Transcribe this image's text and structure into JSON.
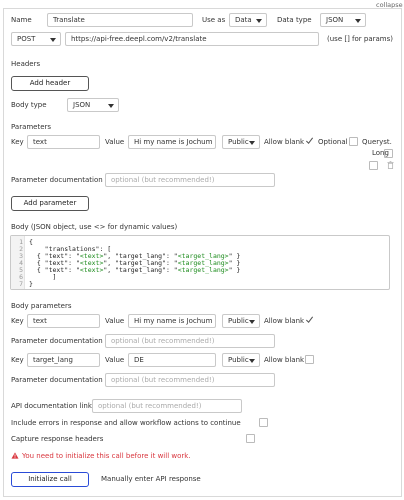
{
  "collapse_label": "collapse",
  "top": {
    "name_label": "Name",
    "name_value": "Translate",
    "use_as_label": "Use as",
    "use_as_value": "Data",
    "data_type_label": "Data type",
    "data_type_value": "JSON",
    "method": "POST",
    "url": "https://api-free.deepl.com/v2/translate",
    "params_hint": "(use [] for params)"
  },
  "headers": {
    "title": "Headers",
    "add_button": "Add header"
  },
  "body_type": {
    "label": "Body type",
    "value": "JSON"
  },
  "parameters": {
    "title": "Parameters",
    "key_label": "Key",
    "key_value": "text",
    "value_label": "Value",
    "value_value": "Hi my name is Jochum",
    "visibility": "Public",
    "allow_blank": "Allow blank",
    "optional": "Optional",
    "querystring": "Queryst.",
    "long": "Long",
    "doc_label": "Parameter documentation",
    "doc_placeholder": "optional (but recommended!)",
    "add_button": "Add parameter"
  },
  "body": {
    "label": "Body (JSON object, use <> for dynamic values)",
    "lines": [
      {
        "n": "1",
        "parts": [
          {
            "t": "{",
            "c": ""
          }
        ]
      },
      {
        "n": "2",
        "parts": [
          {
            "t": "    \"translations\": [",
            "c": ""
          }
        ]
      },
      {
        "n": "3",
        "parts": [
          {
            "t": "  { \"text\": \"",
            "c": ""
          },
          {
            "t": "<text>",
            "c": "tag"
          },
          {
            "t": "\", \"target_lang\": \"",
            "c": ""
          },
          {
            "t": "<target_lang>",
            "c": "tag"
          },
          {
            "t": "\" }",
            "c": ""
          }
        ]
      },
      {
        "n": "4",
        "parts": [
          {
            "t": "  { \"text\": \"",
            "c": ""
          },
          {
            "t": "<text>",
            "c": "tag"
          },
          {
            "t": "\", \"target_lang\": \"",
            "c": ""
          },
          {
            "t": "<target_lang>",
            "c": "tag"
          },
          {
            "t": "\" }",
            "c": ""
          }
        ]
      },
      {
        "n": "5",
        "parts": [
          {
            "t": "  { \"text\": \"",
            "c": ""
          },
          {
            "t": "<text>",
            "c": "tag"
          },
          {
            "t": "\", \"target_lang\": \"",
            "c": ""
          },
          {
            "t": "<target_lang>",
            "c": "tag"
          },
          {
            "t": "\" }",
            "c": ""
          }
        ]
      },
      {
        "n": "6",
        "parts": [
          {
            "t": "      ]",
            "c": ""
          }
        ]
      },
      {
        "n": "7",
        "parts": [
          {
            "t": "}",
            "c": ""
          }
        ]
      }
    ]
  },
  "body_parameters": {
    "title": "Body parameters",
    "rows": [
      {
        "key_label": "Key",
        "key": "text",
        "value_label": "Value",
        "value": "Hi my name is Jochum",
        "visibility": "Public",
        "allow_blank": "Allow blank",
        "checked": true
      },
      {
        "key_label": "Key",
        "key": "target_lang",
        "value_label": "Value",
        "value": "DE",
        "visibility": "Public",
        "allow_blank": "Allow blank",
        "checked": false
      }
    ],
    "doc_label": "Parameter documentation",
    "doc_placeholder": "optional (but recommended!)"
  },
  "api_doc": {
    "label": "API documentation link",
    "placeholder": "optional (but recommended!)"
  },
  "include_errors_label": "Include errors in response and allow workflow actions to continue",
  "capture_headers_label": "Capture response headers",
  "warning": "You need to initialize this call before it will work.",
  "initialize_button": "Initialize call",
  "manual_label": "Manually enter API response",
  "colors": {
    "accent": "#2a4bd7",
    "warning": "#d9363e",
    "code_tag": "#1a8a1a"
  }
}
